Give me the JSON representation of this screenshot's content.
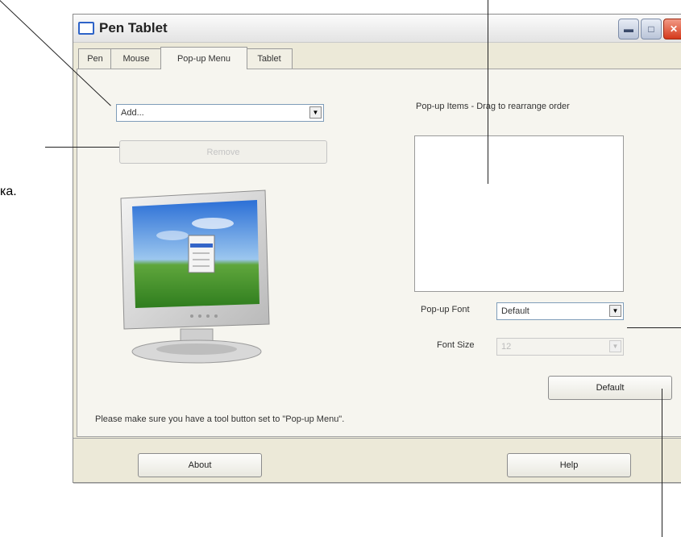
{
  "annotations": {
    "side_note_text": "ка."
  },
  "window": {
    "title": "Pen Tablet",
    "icons": {
      "app": "app-icon",
      "minimize": "minimize-icon",
      "maximize": "maximize-icon",
      "close": "close-icon"
    }
  },
  "tabs": [
    {
      "label": "Pen",
      "active": false
    },
    {
      "label": "Mouse",
      "active": false
    },
    {
      "label": "Pop-up Menu",
      "active": true
    },
    {
      "label": "Tablet",
      "active": false
    }
  ],
  "popup_menu": {
    "add_dropdown": {
      "value": "Add...",
      "icon": "dropdown-arrow-icon"
    },
    "remove_button": "Remove",
    "list_heading": "Pop-up Items - Drag to rearrange order",
    "font_label": "Pop-up Font",
    "font_value": "Default",
    "size_label": "Font Size",
    "size_value": "12",
    "default_button": "Default",
    "footer_note": "Please make sure you have a tool button set to \"Pop-up Menu\".",
    "illustration": "monitor-with-popup-menu-image"
  },
  "bottom_buttons": {
    "about": "About",
    "help": "Help"
  },
  "colors": {
    "window_bg": "#ece9d8",
    "panel_bg": "#f6f5ef",
    "close_button": "#d5391b"
  }
}
